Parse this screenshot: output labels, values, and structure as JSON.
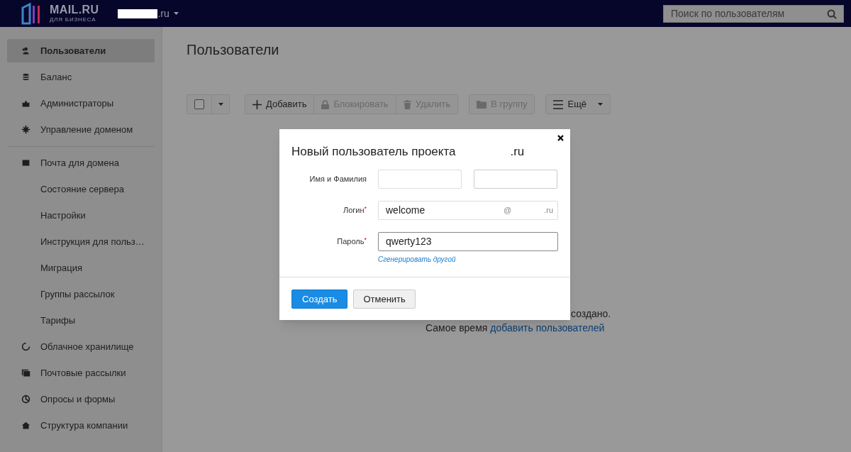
{
  "header": {
    "logo": {
      "name": "MAIL.RU",
      "tagline": "ДЛЯ БИЗНЕСА"
    },
    "domain_suffix": ".ru",
    "search": {
      "placeholder": "Поиск по пользователям"
    }
  },
  "sidebar": {
    "items": [
      {
        "label": "Пользователи",
        "selected": true
      },
      {
        "label": "Баланс",
        "selected": false
      },
      {
        "label": "Администраторы",
        "selected": false
      },
      {
        "label": "Управление доменом",
        "selected": false
      },
      {
        "label": "Почта для домена",
        "selected": false
      },
      {
        "label": "Состояние сервера",
        "selected": false
      },
      {
        "label": "Настройки",
        "selected": false
      },
      {
        "label": "Инструкция для польз…",
        "selected": false
      },
      {
        "label": "Миграция",
        "selected": false
      },
      {
        "label": "Группы рассылок",
        "selected": false
      },
      {
        "label": "Тарифы",
        "selected": false
      },
      {
        "label": "Облачное хранилище",
        "selected": false
      },
      {
        "label": "Почтовые рассылки",
        "selected": false
      },
      {
        "label": "Опросы и формы",
        "selected": false
      },
      {
        "label": "Структура компании",
        "selected": false
      }
    ]
  },
  "main": {
    "title": "Пользователи",
    "toolbar": [
      {
        "group": [
          {
            "kind": "checkbox",
            "checked": false
          },
          {
            "kind": "caret"
          }
        ]
      },
      {
        "group": [
          {
            "kind": "button",
            "label": "Добавить",
            "disabled": false
          },
          {
            "kind": "button",
            "label": "Блокировать",
            "disabled": true
          },
          {
            "kind": "button",
            "label": "Удалить",
            "disabled": true
          }
        ]
      },
      {
        "group": [
          {
            "kind": "button",
            "label": "В группу",
            "disabled": true
          }
        ]
      },
      {
        "group": [
          {
            "kind": "menu",
            "label": "Ещё"
          }
        ]
      }
    ],
    "empty_text": "создано.",
    "empty_prefix": "Самое время",
    "empty_link": "добавить пользователей"
  },
  "dialog": {
    "title": "Новый пользователь проекта",
    "title_suffix": ".ru",
    "name_label": "Имя и Фамилия",
    "login": {
      "label": "Логин",
      "required_mark": "*",
      "value": "welcome",
      "at": "@",
      "suffix": ".ru"
    },
    "password": {
      "label": "Пароль",
      "required_mark": "*",
      "value": "qwerty123"
    },
    "generate_link": "Сгенерировать другой",
    "buttons": [
      {
        "label": "Создать",
        "primary": true
      },
      {
        "label": "Отменить",
        "primary": false
      }
    ]
  }
}
